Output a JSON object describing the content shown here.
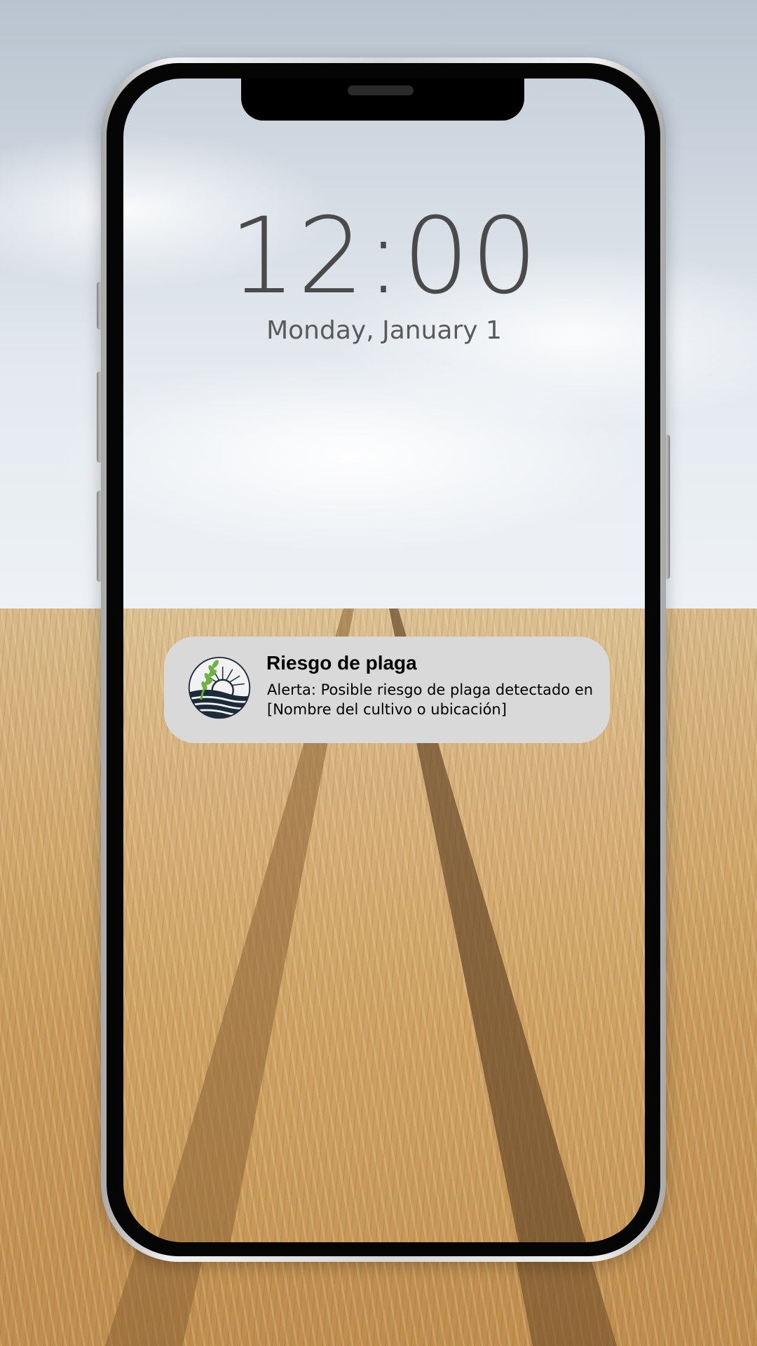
{
  "lock_screen": {
    "time": "12:00",
    "date": "Monday, January 1"
  },
  "notification": {
    "app_icon": "wheat-sunrise-logo-icon",
    "title": "Riesgo de plaga",
    "body": "Alerta: Posible riesgo de plaga detectado en [Nombre del cultivo o ubicación]"
  },
  "wallpaper": {
    "subject": "wheat-field-with-tractor-tracks"
  },
  "colors": {
    "notification_bg": "#d9d9d9",
    "clock_text": "#4a4a4a",
    "logo_navy": "#1c2b3a",
    "logo_green": "#6cb33f"
  }
}
